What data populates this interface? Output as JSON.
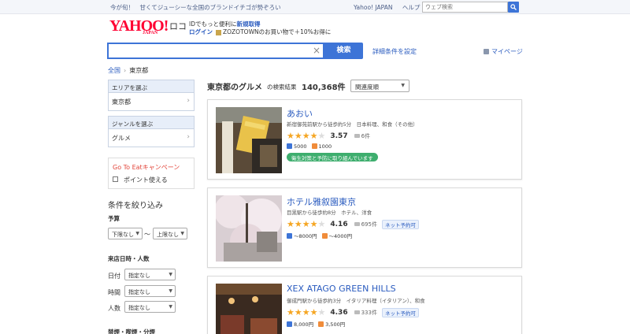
{
  "promo": {
    "message": "今が旬！　甘くてジューシーな全国のブランドイチゴが勢ぞろい",
    "links": [
      "Yahoo! JAPAN",
      "ヘルプ"
    ],
    "web_search_placeholder": "ウェブ検索"
  },
  "header": {
    "logo_text": "YAHOO!",
    "logo_sub": "JAPAN",
    "service_name": "ロコ",
    "login_line1_prefix": "IDでもっと便利に",
    "login_line1_link": "新規取得",
    "login_link": "ログイン",
    "zozo_text": "ZOZOTOWNのお買い物で＋10%お得に"
  },
  "search": {
    "value": "",
    "clear_glyph": "×",
    "button_label": "検索",
    "detail_link": "詳細条件を設定",
    "mypage": "マイページ"
  },
  "breadcrumb": {
    "root": "全国",
    "separator": "›",
    "current": "東京都"
  },
  "sidebar": {
    "area": {
      "heading": "エリアを選ぶ",
      "value": "東京都"
    },
    "genre": {
      "heading": "ジャンルを選ぶ",
      "value": "グルメ"
    },
    "goto": {
      "title": "Go To Eatキャンペーン",
      "checkbox_label": "ポイント使える"
    },
    "filter_title": "条件を絞り込み",
    "budget": {
      "label": "予算",
      "min": "下限なし",
      "tilde": "〜",
      "max": "上限なし"
    },
    "visit": {
      "label": "来店日時・人数",
      "date_label": "日付",
      "date_value": "指定なし",
      "time_label": "時間",
      "time_value": "指定なし",
      "people_label": "人数",
      "people_value": "指定なし"
    },
    "next_section": "禁煙・喫煙・分煙"
  },
  "results": {
    "title": "東京都のグルメ",
    "count_label": "の検索結果",
    "count": "140,368件",
    "sort": "関連度順",
    "items": [
      {
        "name": "あおい",
        "meta": "新宿御苑前駅から徒歩約5分　日本料理、和食（その他）",
        "rating": 3.57,
        "score": "3.57",
        "reviews": "6件",
        "lunch": "5000",
        "dinner": "1000",
        "badge": "",
        "safety": "衛生対策と予防に取り組んでいます"
      },
      {
        "name": "ホテル雅叙園東京",
        "meta": "目黒駅から徒歩約8分　ホテル、洋食",
        "rating": 4.16,
        "score": "4.16",
        "reviews": "695件",
        "lunch": "〜8000円",
        "dinner": "〜4000円",
        "badge": "ネット予約可",
        "safety": ""
      },
      {
        "name": "XEX ATAGO GREEN HILLS",
        "meta": "御成門駅から徒歩約3分　イタリア料理（イタリアン）、和食",
        "rating": 4.36,
        "score": "4.36",
        "reviews": "333件",
        "lunch": "8,000円",
        "dinner": "3,500円",
        "badge": "ネット予約可",
        "safety": ""
      }
    ]
  }
}
